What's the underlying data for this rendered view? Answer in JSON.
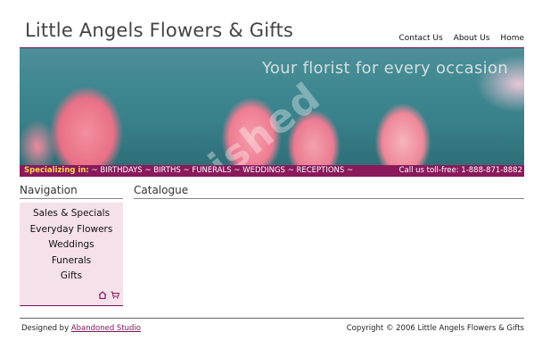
{
  "header": {
    "site_title": "Little Angels Flowers & Gifts",
    "links": [
      "Contact Us",
      "About Us",
      "Home"
    ]
  },
  "banner": {
    "tagline": "Your florist for every occasion",
    "watermark": "unfinished"
  },
  "specialty_bar": {
    "label": "Specializing in:",
    "items": "~ BIRTHDAYS ~ BIRTHS ~ FUNERALS ~ WEDDINGS ~ RECEPTIONS ~",
    "phone": "Call us toll-free: 1-888-871-8882"
  },
  "sidebar": {
    "title": "Navigation",
    "items": [
      "Sales & Specials",
      "Everyday Flowers",
      "Weddings",
      "Funerals",
      "Gifts"
    ],
    "icons": [
      "home-icon",
      "cart-icon"
    ]
  },
  "main": {
    "title": "Catalogue"
  },
  "footer": {
    "designed_by_prefix": "Designed by",
    "designer_link": "Abandoned Studio",
    "copyright": "Copyright © 2006 Little Angels Flowers & Gifts"
  },
  "colors": {
    "accent": "#8a1a5c",
    "highlight": "#ffd54a",
    "nav_bg": "#f5e1ea"
  }
}
